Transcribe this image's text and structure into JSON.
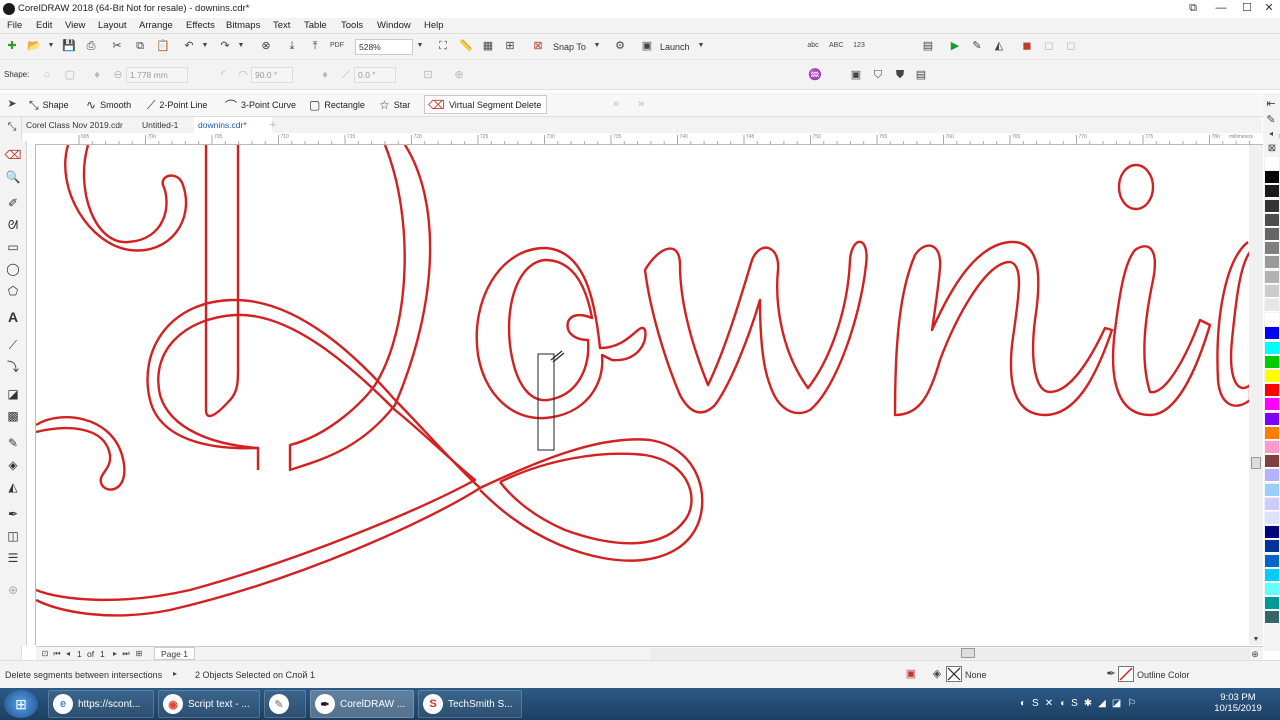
{
  "window": {
    "title": "CorelDRAW 2018 (64-Bit Not for resale) - downins.cdr*",
    "buttons": [
      "⧉",
      "—",
      "☐",
      "✕"
    ]
  },
  "menu": [
    "File",
    "Edit",
    "View",
    "Layout",
    "Arrange",
    "Effects",
    "Bitmaps",
    "Text",
    "Table",
    "Tools",
    "Window",
    "Help"
  ],
  "standard_toolbar": {
    "zoom": "528%",
    "snap_to": "Snap To",
    "launch": "Launch"
  },
  "property_bar": {
    "shape_label": "Shape:",
    "outline_width": "1.778 mm",
    "angle": "90.0 °",
    "angle2": "0.0 °"
  },
  "tool_options": [
    {
      "label": "Shape",
      "icon": "shape-tool-icon"
    },
    {
      "label": "Smooth",
      "icon": "smooth-tool-icon"
    },
    {
      "label": "2-Point Line",
      "icon": "two-point-line-icon"
    },
    {
      "label": "3-Point Curve",
      "icon": "three-point-curve-icon"
    },
    {
      "label": "Rectangle",
      "icon": "rectangle-icon"
    },
    {
      "label": "Star",
      "icon": "star-icon"
    },
    {
      "label": "Virtual Segment Delete",
      "icon": "virtual-segment-delete-icon"
    }
  ],
  "doc_tabs": [
    "Corel Class Nov 2019.cdr",
    "Untitled-1",
    "downins.cdr*"
  ],
  "ruler": {
    "units": "millimeters",
    "ticks": [
      "695",
      "700",
      "705",
      "710",
      "715",
      "720",
      "725",
      "730",
      "735",
      "740",
      "745",
      "750",
      "755",
      "760",
      "765",
      "770",
      "775",
      "780",
      "785"
    ]
  },
  "page_nav": {
    "current": "1",
    "of_label": "of",
    "total": "1",
    "page_tab": "Page 1"
  },
  "status": {
    "hint": "Delete segments between intersections",
    "selection": "2 Objects Selected on Слой 1",
    "fill_label": "None",
    "outline_label": "Outline Color"
  },
  "palette_colors": [
    "#ffffff",
    "#000000",
    "#1a1a1a",
    "#333333",
    "#4d4d4d",
    "#666666",
    "#808080",
    "#999999",
    "#b3b3b3",
    "#cccccc",
    "#e6e6e6",
    "#ffffff",
    "#0000ff",
    "#00ffff",
    "#00cc00",
    "#ffff00",
    "#ff0000",
    "#ff00ff",
    "#8000ff",
    "#ff8000",
    "#ff99cc",
    "#804040",
    "#b3b3ff",
    "#99ccff",
    "#ccccff",
    "#e0e0ff",
    "#000080",
    "#003399",
    "#0066cc",
    "#00ccff",
    "#66ffff",
    "#009999",
    "#336666"
  ],
  "accent_stroke": "#d32020",
  "taskbar": {
    "tasks": [
      {
        "label": "https://scont...",
        "icon": "internet-explorer-icon",
        "glyph": "e",
        "color": "#3a8ee6"
      },
      {
        "label": "Script text - ...",
        "icon": "chrome-icon",
        "glyph": "◉",
        "color": "#e34234"
      },
      {
        "label": "",
        "icon": "paint-icon",
        "glyph": "✎",
        "color": "#aaaaaa"
      },
      {
        "label": "CorelDRAW ...",
        "icon": "coreldraw-icon",
        "glyph": "✒",
        "color": "#111111"
      },
      {
        "label": "TechSmith S...",
        "icon": "techsmith-icon",
        "glyph": "S",
        "color": "#d8282e"
      }
    ],
    "time": "9:03 PM",
    "date": "10/15/2019"
  }
}
